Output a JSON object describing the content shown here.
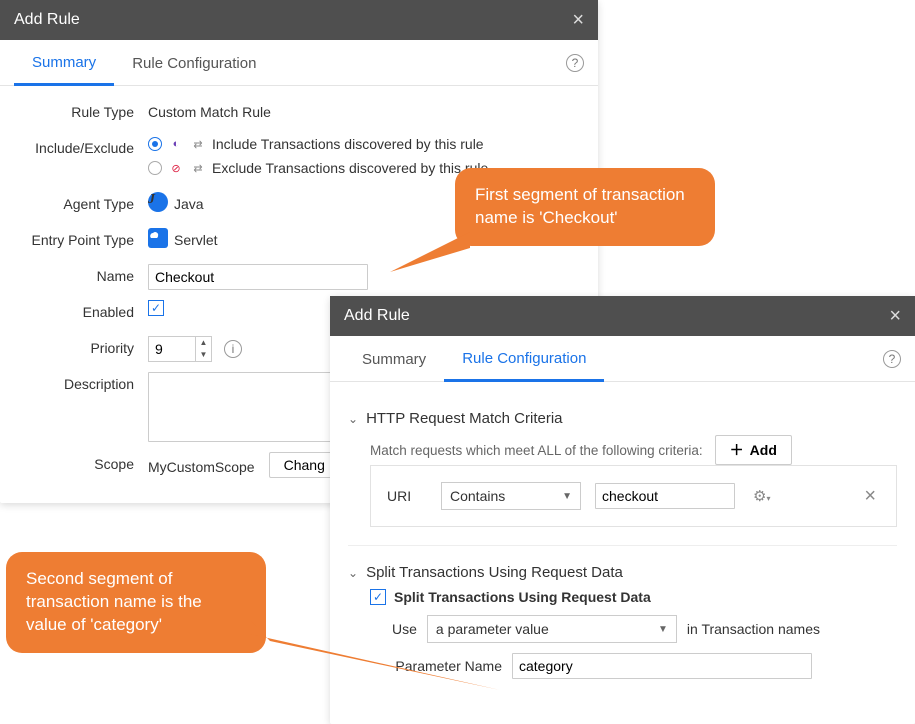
{
  "dialog1": {
    "title": "Add Rule",
    "tabs": {
      "summary": "Summary",
      "config": "Rule Configuration"
    },
    "labels": {
      "ruleType": "Rule Type",
      "includeExclude": "Include/Exclude",
      "agentType": "Agent Type",
      "entryPointType": "Entry Point Type",
      "name": "Name",
      "enabled": "Enabled",
      "priority": "Priority",
      "description": "Description",
      "scope": "Scope"
    },
    "values": {
      "ruleType": "Custom Match Rule",
      "includeText": "Include Transactions discovered by this rule",
      "excludeText": "Exclude Transactions discovered by this rule",
      "agentType": "Java",
      "entryPointType": "Servlet",
      "name": "Checkout",
      "priority": "9",
      "scope": "MyCustomScope",
      "changeScopeBtn": "Chang"
    }
  },
  "dialog2": {
    "title": "Add Rule",
    "tabs": {
      "summary": "Summary",
      "config": "Rule Configuration"
    },
    "http": {
      "heading": "HTTP Request Match Criteria",
      "hint": "Match requests which meet ALL of the following criteria:",
      "addBtn": "Add",
      "uriLabel": "URI",
      "condition": "Contains",
      "value": "checkout"
    },
    "split": {
      "heading": "Split Transactions Using Request Data",
      "checkboxLabel": "Split Transactions Using Request Data",
      "useLabel": "Use",
      "useValue": "a parameter value",
      "suffix": "in Transaction names",
      "paramLabel": "Parameter Name",
      "paramValue": "category"
    }
  },
  "callouts": {
    "c1": "First segment of transaction name is 'Checkout'",
    "c2": "Second segment of transaction name is the value of 'category'"
  }
}
